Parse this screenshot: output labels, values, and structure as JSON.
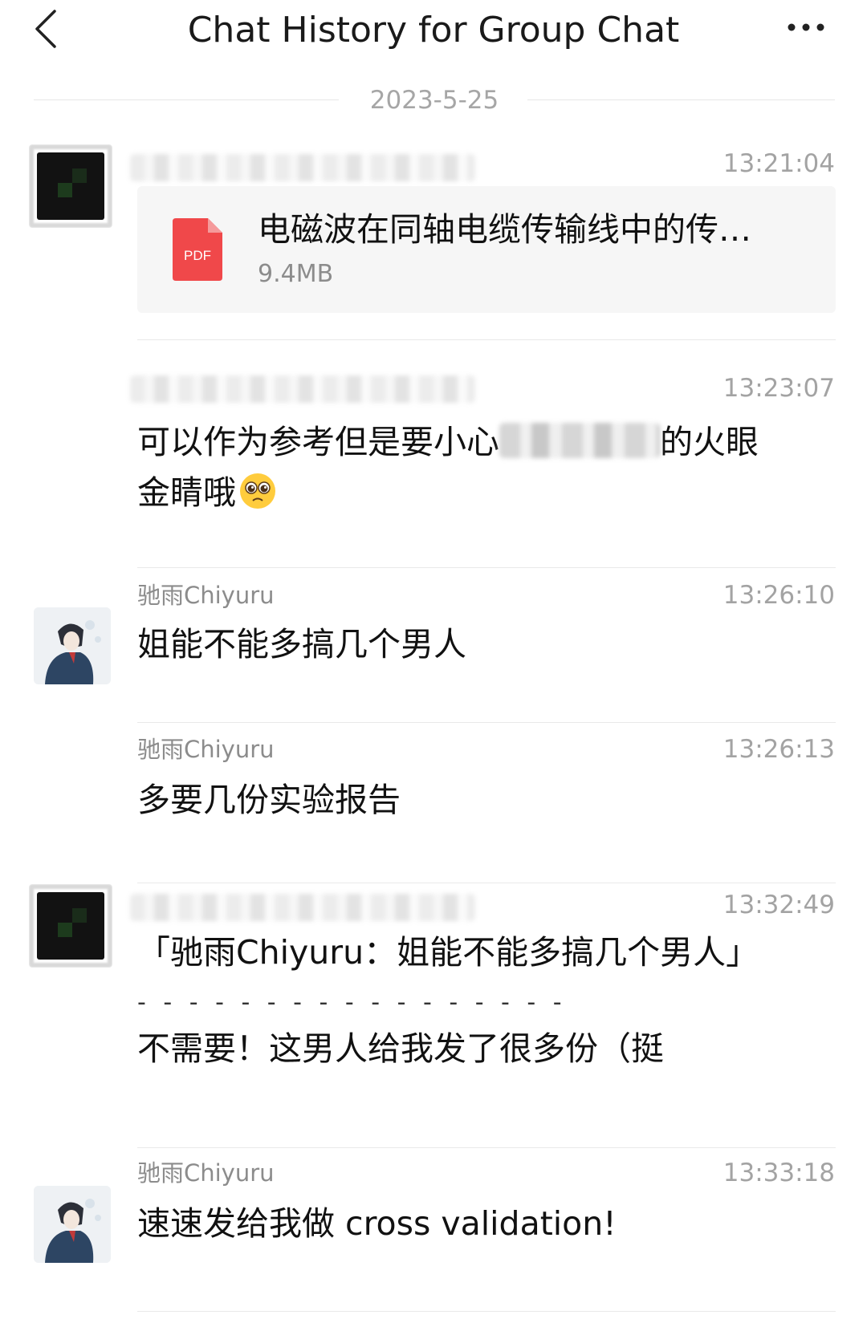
{
  "header": {
    "title": "Chat History for Group Chat",
    "back_icon": "chevron-left-icon",
    "more_icon": "more-horizontal-icon"
  },
  "date_divider": "2023-5-25",
  "messages": [
    {
      "sender": "",
      "time": "13:21:04",
      "file": {
        "icon": "pdf-icon",
        "icon_label": "PDF",
        "name": "电磁波在同轴电缆传输线中的传…",
        "size": "9.4MB"
      }
    },
    {
      "sender": "",
      "time": "13:23:07",
      "text_before": "可以作为参考但是要小心",
      "text_after": "的火眼",
      "text_line2": "金睛哦",
      "emoji": "pleading-face-icon"
    },
    {
      "sender": "驰雨Chiyuru",
      "time": "13:26:10",
      "text": "姐能不能多搞几个男人"
    },
    {
      "sender": "驰雨Chiyuru",
      "time": "13:26:13",
      "text": "多要几份实验报告"
    },
    {
      "sender": "",
      "time": "13:32:49",
      "quote": "「驰雨Chiyuru：姐能不能多搞几个男人」",
      "divider": "- - - - - - - - - - - - - - - - -",
      "text": "不需要！这男人给我发了很多份（挺"
    },
    {
      "sender": "驰雨Chiyuru",
      "time": "13:33:18",
      "text": "速速发给我做 cross validation!"
    }
  ],
  "colors": {
    "pdf_red": "#f0484a",
    "text_secondary": "#8c8c8c",
    "file_card_bg": "#f6f6f6"
  }
}
